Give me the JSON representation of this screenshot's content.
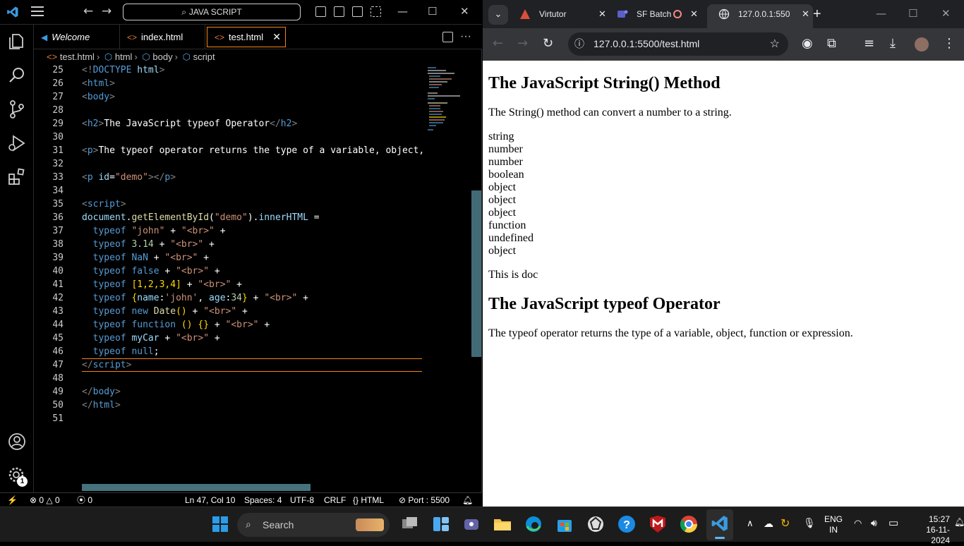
{
  "vscode": {
    "search_label": "JAVA SCRIPT",
    "tabs": [
      {
        "label": "Welcome"
      },
      {
        "label": "index.html"
      },
      {
        "label": "test.html"
      }
    ],
    "breadcrumb": [
      "test.html",
      "html",
      "body",
      "script"
    ],
    "lines": [
      {
        "n": "25"
      },
      {
        "n": "26"
      },
      {
        "n": "27"
      },
      {
        "n": "28"
      },
      {
        "n": "29"
      },
      {
        "n": "30"
      },
      {
        "n": "31"
      },
      {
        "n": "32"
      },
      {
        "n": "33"
      },
      {
        "n": "34"
      },
      {
        "n": "35"
      },
      {
        "n": "36"
      },
      {
        "n": "37"
      },
      {
        "n": "38"
      },
      {
        "n": "39"
      },
      {
        "n": "40"
      },
      {
        "n": "41"
      },
      {
        "n": "42"
      },
      {
        "n": "43"
      },
      {
        "n": "44"
      },
      {
        "n": "45"
      },
      {
        "n": "46"
      },
      {
        "n": "47"
      },
      {
        "n": "48"
      },
      {
        "n": "49"
      },
      {
        "n": "50"
      },
      {
        "n": "51"
      }
    ],
    "code": {
      "l25_tag": "DOCTYPE",
      "l25_kw": "html",
      "l26": "html",
      "l27": "body",
      "l29_text": "The JavaScript typeof Operator",
      "l31_text": "The typeof operator returns the type of a variable, object,",
      "l33_attr": "id",
      "l33_val": "\"demo\"",
      "l35": "script",
      "l36_doc": "document",
      "l36_fn": "getElementById",
      "l36_arg": "\"demo\"",
      "l36_prop": "innerHTML",
      "typeof": "typeof",
      "br": "\"<br>\"",
      "l37_v": "\"john\"",
      "l38_v": "3.14",
      "l39_v": "NaN",
      "l40_v": "false",
      "l41_v": "[1,2,3,4]",
      "l42_name": "name",
      "l42_nv": "'john'",
      "l42_age": "age",
      "l42_av": "34",
      "l43_new": "new",
      "l43_fn": "Date",
      "l44_kw": "function",
      "l45_v": "myCar",
      "l46_v": "null"
    },
    "status": {
      "errors": "0",
      "warnings": "0",
      "ports": "0",
      "position": "Ln 47, Col 10",
      "spaces": "Spaces: 4",
      "encoding": "UTF-8",
      "eol": "CRLF",
      "language": "HTML",
      "port": "Port : 5500"
    },
    "settings_badge": "1"
  },
  "chrome": {
    "tabs": [
      {
        "label": "Virtutor"
      },
      {
        "label": "SF Batch"
      },
      {
        "label": "127.0.0.1:550"
      }
    ],
    "url": "127.0.0.1:5500/test.html",
    "page": {
      "h1": "The JavaScript String() Method",
      "p1": "The String() method can convert a number to a string.",
      "types": [
        "string",
        "number",
        "number",
        "boolean",
        "object",
        "object",
        "object",
        "function",
        "undefined",
        "object"
      ],
      "doc": "This is doc",
      "h2": "The JavaScript typeof Operator",
      "p2": "The typeof operator returns the type of a variable, object, function or expression."
    }
  },
  "taskbar": {
    "search": "Search",
    "lang1": "ENG",
    "lang2": "IN",
    "time": "15:27",
    "date": "16-11-2024"
  },
  "colors": {
    "accent": "#f38518",
    "vscode_blue": "#007acc",
    "tag": "#569cd6",
    "string": "#ce9178"
  }
}
